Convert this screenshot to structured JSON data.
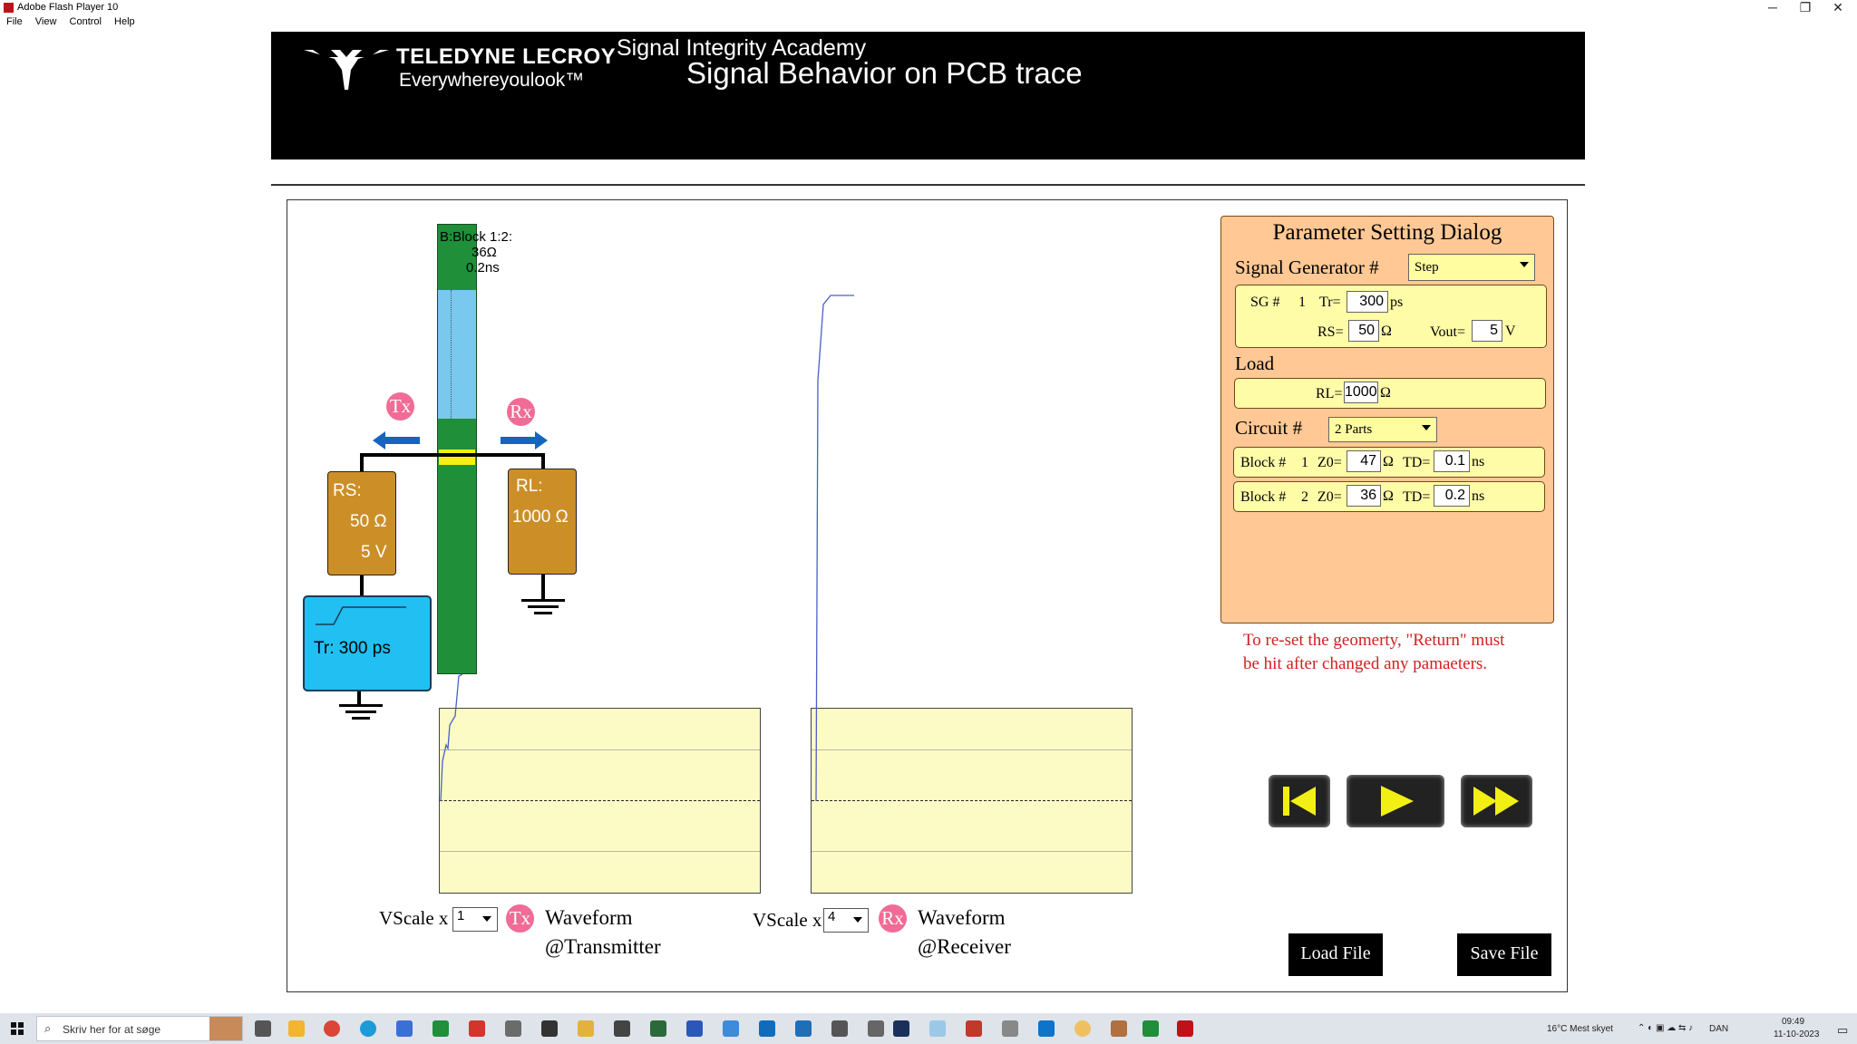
{
  "window": {
    "title": "Adobe Flash Player 10",
    "controls": [
      "─",
      "❐",
      "✕"
    ]
  },
  "menu": [
    "File",
    "View",
    "Control",
    "Help"
  ],
  "banner": {
    "brand_line1": "TELEDYNE LECROY",
    "brand_line2": "Everywhereyoulook™",
    "subtitle": "Signal Integrity Academy",
    "title": "Signal Behavior on PCB trace"
  },
  "circuit": {
    "trace_label_a": "B:Block 1:2:",
    "trace_label_b": "36Ω",
    "trace_label_c": "0.2ns",
    "rs_title": "RS:",
    "rs_value": "50 Ω",
    "rs_voltage": "5 V",
    "rl_title": "RL:",
    "rl_value": "1000 Ω",
    "tr_label": "Tr:  300  ps",
    "tx_badge": "Tx",
    "rx_badge": "Rx"
  },
  "waveforms": {
    "tx": {
      "vscale_label": "VScale x",
      "vscale_value": "1",
      "badge": "Tx",
      "caption_1": "Waveform",
      "caption_2": "@Transmitter"
    },
    "rx": {
      "vscale_label": "VScale x",
      "vscale_value": "4",
      "badge": "Rx",
      "caption_1": "Waveform",
      "caption_2": "@Receiver"
    }
  },
  "dialog": {
    "title": "Parameter Setting Dialog",
    "sg_label": "Signal Generator #",
    "sg_type": "Step",
    "sg": {
      "prefix": "SG #",
      "num": "1",
      "tr_label": "Tr=",
      "tr_value": "300",
      "tr_unit": "ps",
      "rs_label": "RS=",
      "rs_value": "50",
      "rs_unit": "Ω",
      "vout_label": "Vout=",
      "vout_value": "5",
      "vout_unit": "V"
    },
    "load_label": "Load",
    "load": {
      "rl_label": "RL=",
      "rl_value": "1000",
      "rl_unit": "Ω"
    },
    "circuit_label": "Circuit #",
    "circuit_type": "2 Parts",
    "blocks": [
      {
        "prefix": "Block #",
        "num": "1",
        "z0_label": "Z0=",
        "z0_value": "47",
        "z0_unit": "Ω",
        "td_label": "TD=",
        "td_value": "0.1",
        "td_unit": "ns"
      },
      {
        "prefix": "Block #",
        "num": "2",
        "z0_label": "Z0=",
        "z0_value": "36",
        "z0_unit": "Ω",
        "td_label": "TD=",
        "td_value": "0.2",
        "td_unit": "ns"
      }
    ]
  },
  "note_line1": "To re-set  the geomerty, \"Return\" must",
  "note_line2": "be hit after changed any pamaeters.",
  "buttons": {
    "load": "Load File",
    "save": "Save File"
  },
  "taskbar": {
    "search_placeholder": "Skriv her for at søge",
    "weather": "16°C  Mest skyet",
    "lang": "DAN",
    "time": "09:49",
    "date": "11-10-2023"
  },
  "colors": {
    "trace_green": "#1f8f3a",
    "trace_blue": "#79c8ee",
    "dialog_bg": "#ffc894",
    "wave_bg": "#fdfbc5",
    "badge_pink": "#f06c96",
    "brown": "#cc8f28",
    "cyan": "#21bff2"
  }
}
